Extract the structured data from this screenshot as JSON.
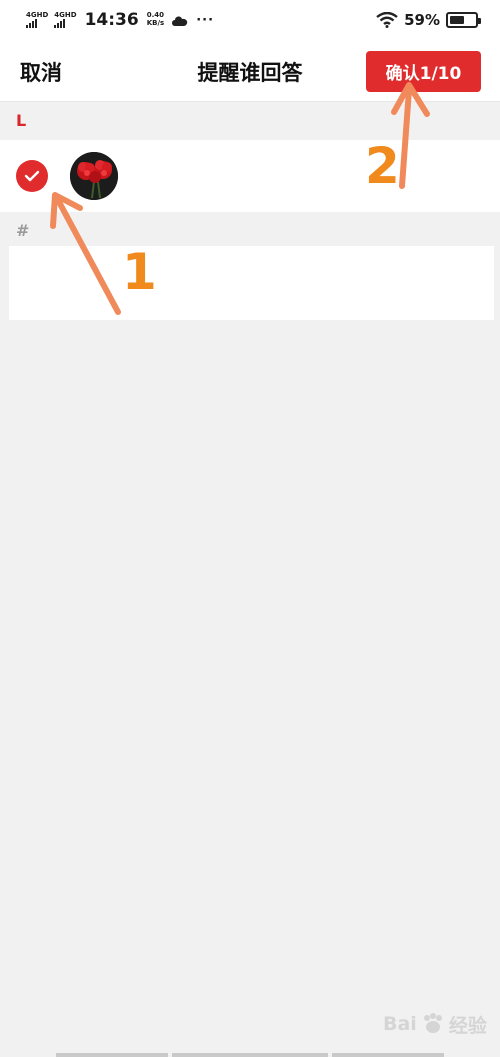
{
  "status_bar": {
    "network1": "4GHD",
    "network2": "4GHD",
    "time": "14:36",
    "speed_value": "0.40",
    "speed_unit": "KB/s",
    "more": "···",
    "battery_percent": "59%",
    "battery_level": 0.59
  },
  "nav": {
    "cancel_label": "取消",
    "title": "提醒谁回答",
    "confirm_label": "确认1/10"
  },
  "sections": [
    {
      "letter": "L",
      "color": "#d8262c"
    },
    {
      "letter": "#",
      "color": "#9a9a9a"
    }
  ],
  "contact": {
    "selected": true,
    "avatar": "red-carnation-avatar"
  },
  "annotations": {
    "label_1": "1",
    "label_2": "2",
    "arrow_color": "#f08a5a",
    "number_color": "#f08a1c"
  },
  "watermark": {
    "text": "Bai",
    "suffix": "经验"
  },
  "colors": {
    "accent": "#e02c2c",
    "background": "#f2f1f2"
  }
}
